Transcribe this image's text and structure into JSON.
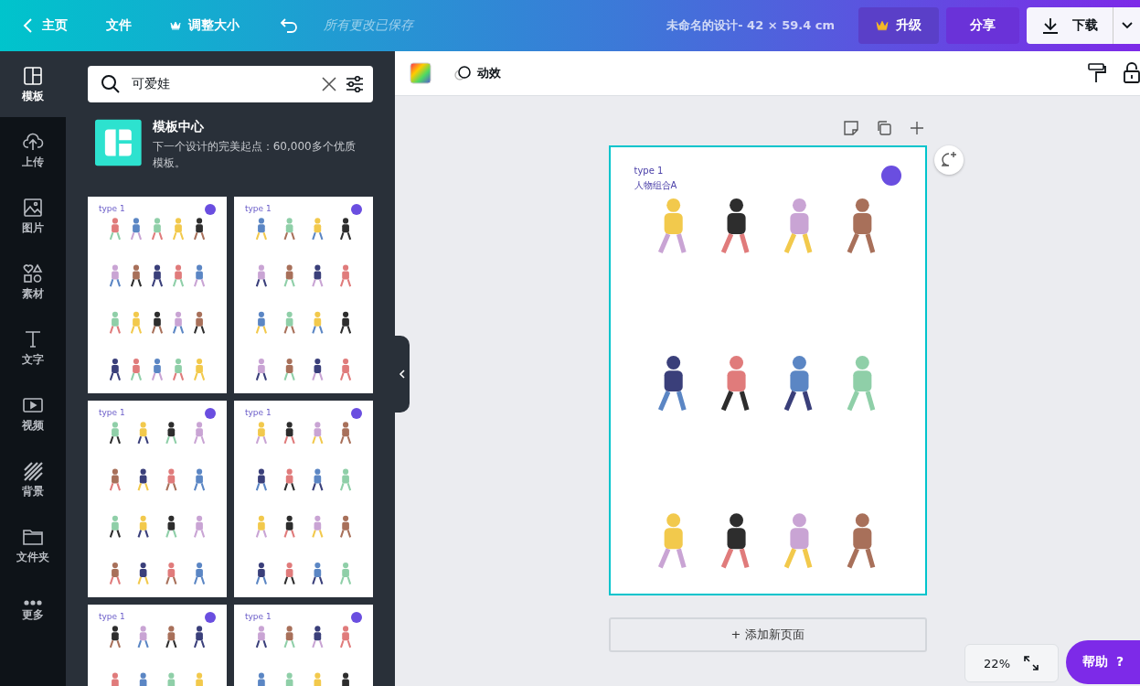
{
  "topbar": {
    "back": "主页",
    "file": "文件",
    "resize": "调整大小",
    "save_status": "所有更改已保存",
    "title": "未命名的设计- 42 × 59.4 cm",
    "upgrade": "升级",
    "share": "分享",
    "download": "下载"
  },
  "rail": [
    {
      "label": "模板",
      "selected": true
    },
    {
      "label": "上传",
      "selected": false
    },
    {
      "label": "图片",
      "selected": false
    },
    {
      "label": "素材",
      "selected": false
    },
    {
      "label": "文字",
      "selected": false
    },
    {
      "label": "视频",
      "selected": false
    },
    {
      "label": "背景",
      "selected": false
    },
    {
      "label": "文件夹",
      "selected": false
    },
    {
      "label": "更多",
      "selected": false
    }
  ],
  "search": {
    "value": "可爱娃"
  },
  "promo": {
    "title": "模板中心",
    "text": "下一个设计的完美起点：60,000多个优质模板。"
  },
  "templates": [
    {
      "title": "type 1"
    },
    {
      "title": "type 1"
    },
    {
      "title": "type 1"
    },
    {
      "title": "type 1"
    },
    {
      "title": "type 1"
    },
    {
      "title": "type 1"
    }
  ],
  "toolbar": {
    "effects": "动效"
  },
  "page": {
    "title": "type 1",
    "subtitle": "人物组合A"
  },
  "add_page": "+ 添加新页面",
  "zoom": "22%",
  "help": "帮助",
  "help_icon": "?"
}
